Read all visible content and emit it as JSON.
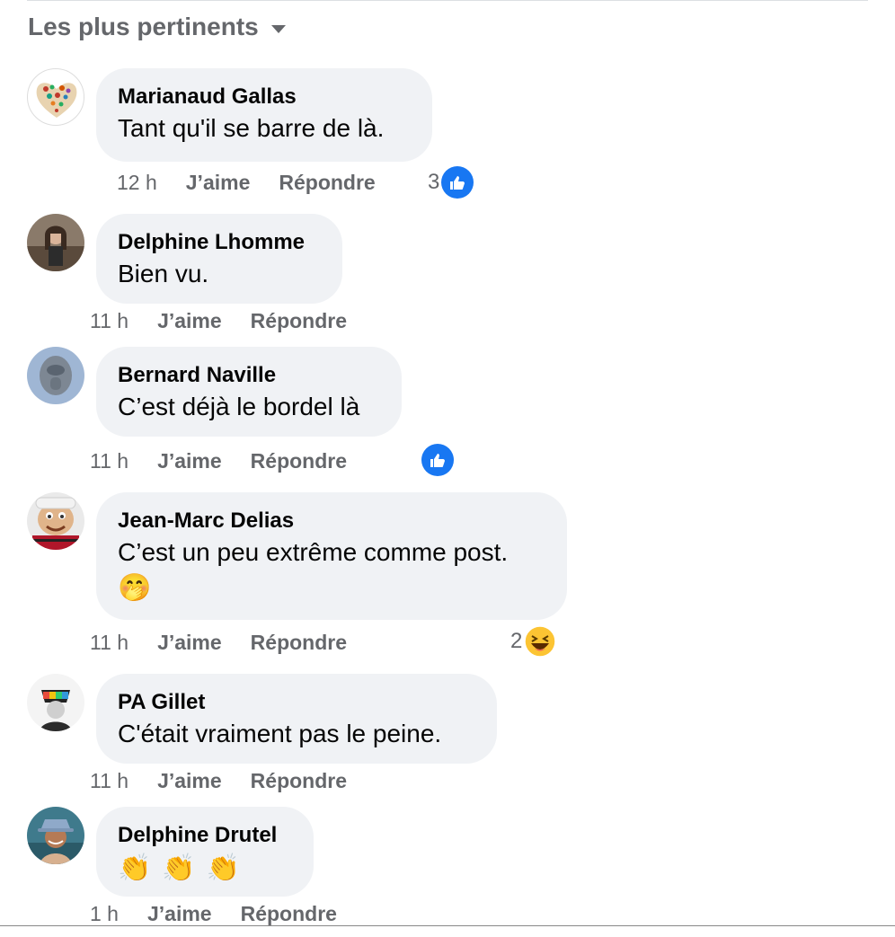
{
  "sort": {
    "label": "Les plus pertinents"
  },
  "actions": {
    "like": "J’aime",
    "reply": "Répondre"
  },
  "comments": [
    {
      "author": "Marianaud Gallas",
      "text": "Tant qu'il se barre de là.",
      "time": "12 h",
      "reactions": {
        "count": "3",
        "type": "like"
      }
    },
    {
      "author": "Delphine Lhomme",
      "text": "Bien vu.",
      "time": "11 h"
    },
    {
      "author": "Bernard Naville",
      "text": "C’est déjà le bordel là",
      "time": "11 h",
      "reactions": {
        "count": "",
        "type": "like"
      }
    },
    {
      "author": "Jean-Marc Delias",
      "text": "C’est un peu extrême comme post.",
      "emoji": "🤭",
      "time": "11 h",
      "reactions": {
        "count": "2",
        "type": "haha"
      }
    },
    {
      "author": "PA Gillet",
      "text": "C'était vraiment pas le peine.",
      "time": "11 h"
    },
    {
      "author": "Delphine Drutel",
      "emojis": [
        "👏",
        "👏",
        "👏"
      ],
      "time": "1 h"
    }
  ],
  "colors": {
    "like_blue": "#1877f2",
    "bubble": "#f0f2f5",
    "secondary_text": "#65676b"
  }
}
